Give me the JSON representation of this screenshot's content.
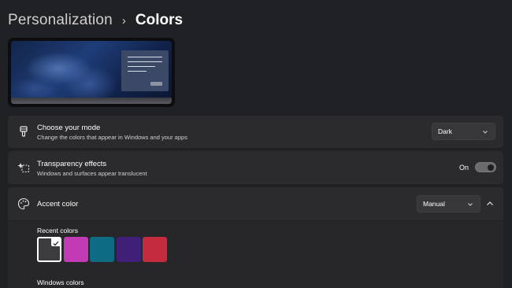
{
  "breadcrumb": {
    "parent": "Personalization",
    "separator": "›",
    "current": "Colors"
  },
  "mode": {
    "title": "Choose your mode",
    "subtitle": "Change the colors that appear in Windows and your apps",
    "value": "Dark"
  },
  "transparency": {
    "title": "Transparency effects",
    "subtitle": "Windows and surfaces appear translucent",
    "state_label": "On",
    "enabled": true
  },
  "accent": {
    "title": "Accent color",
    "value": "Manual",
    "expanded": true,
    "recent_label": "Recent colors",
    "windows_label": "Windows colors",
    "recent_colors": [
      "#3c3c3e",
      "#c23bb4",
      "#0e6b84",
      "#3f1f78",
      "#c42b3d"
    ],
    "selected_index": 0
  },
  "colors": {
    "background": "#202124",
    "card": "#2b2b2d",
    "text": "#ffffff"
  }
}
